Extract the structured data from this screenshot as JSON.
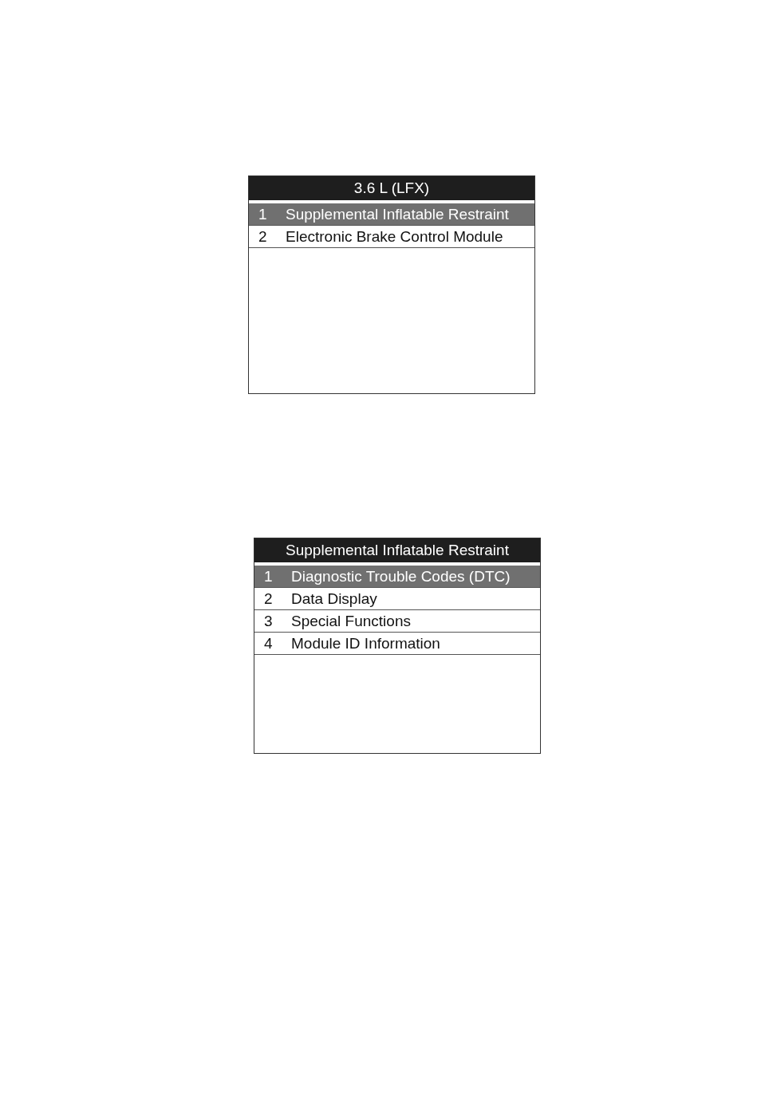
{
  "screens": [
    {
      "title": "3.6 L (LFX)",
      "items": [
        {
          "number": "1",
          "label": "Supplemental Inflatable Restraint",
          "selected": true
        },
        {
          "number": "2",
          "label": "Electronic Brake Control Module",
          "selected": false
        }
      ]
    },
    {
      "title": "Supplemental Inflatable Restraint",
      "items": [
        {
          "number": "1",
          "label": "Diagnostic Trouble Codes (DTC)",
          "selected": true
        },
        {
          "number": "2",
          "label": "Data Display",
          "selected": false
        },
        {
          "number": "3",
          "label": "Special Functions",
          "selected": false
        },
        {
          "number": "4",
          "label": "Module ID Information",
          "selected": false
        }
      ]
    }
  ]
}
